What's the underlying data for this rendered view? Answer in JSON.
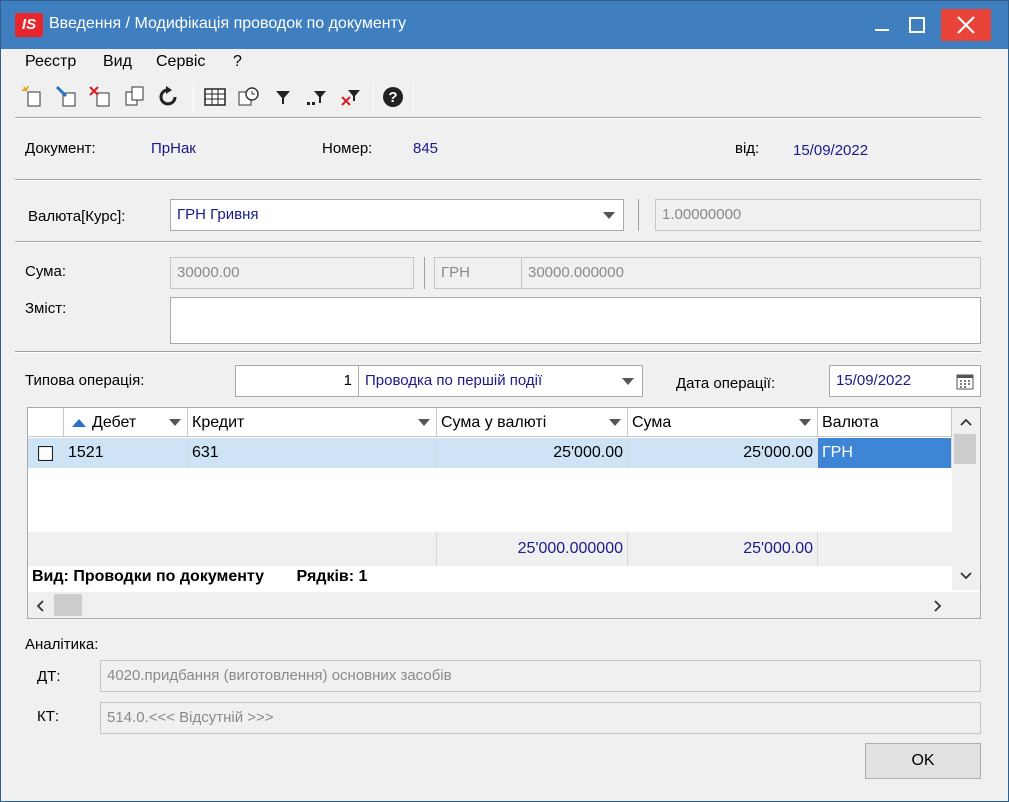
{
  "window": {
    "app_icon_text": "IS",
    "title": "Введення / Модифікація проводок по документу"
  },
  "menu": [
    "Реєстр",
    "Вид",
    "Сервіс",
    "?"
  ],
  "header": {
    "document_label": "Документ:",
    "document_value": "ПрНак",
    "number_label": "Номер:",
    "number_value": "845",
    "date_label": "від:",
    "date_value": "15/09/2022"
  },
  "currency": {
    "label": "Валюта[Курс]:",
    "value": "ГРН Гривня",
    "rate": "1.00000000"
  },
  "sum": {
    "label": "Сума:",
    "value": "30000.00",
    "currency": "ГРН",
    "value_currency": "30000.000000"
  },
  "content": {
    "label": "Зміст:",
    "value": ""
  },
  "operation": {
    "label": "Типова операція:",
    "number": "1",
    "name": "Проводка по першій події",
    "date_label": "Дата операції:",
    "date_value": "15/09/2022"
  },
  "table": {
    "columns": [
      "Дебет",
      "Кредит",
      "Сума у валюті",
      "Сума",
      "Валюта"
    ],
    "rows": [
      {
        "debit": "1521",
        "credit": "631",
        "sum_currency": "25'000.00",
        "sum": "25'000.00",
        "currency": "ГРН"
      }
    ],
    "totals": {
      "sum_currency": "25'000.000000",
      "sum": "25'000.00"
    },
    "view_label": "Вид: Проводки по документу",
    "rows_label": "Рядків: 1"
  },
  "analytics": {
    "label": "Аналітика:",
    "dt_label": "ДТ:",
    "dt_value": "4020.придбання (виготовлення) основних засобів",
    "kt_label": "КТ:",
    "kt_value": "514.0.<<< Відсутній >>>"
  },
  "ok_label": "OK"
}
